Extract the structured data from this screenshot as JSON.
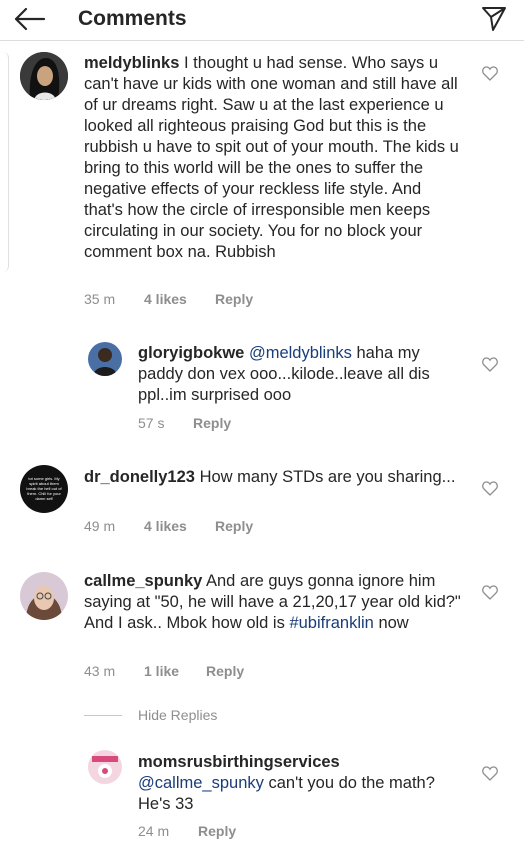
{
  "header": {
    "title": "Comments",
    "back_icon": "arrow-left-icon",
    "send_icon": "paper-plane-icon"
  },
  "comments": [
    {
      "username": "meldyblinks",
      "text": "I thought u had sense. Who says u can't have ur kids with one woman and still have all of ur dreams right. Saw u at the last experience u looked all righteous praising God but this is the rubbish u have to spit out of your mouth. The kids u bring to this world will be the ones to suffer the negative effects of your reckless life style. And that's how the circle of irresponsible men keeps circulating in our society. You for no block your comment box na. Rubbish",
      "time": "35 m",
      "likes": "4 likes",
      "reply": "Reply",
      "replies": [
        {
          "username": "gloryigbokwe",
          "mention": "@meldyblinks",
          "text": "haha my paddy don vex ooo...kilode..leave all dis ppl..im surprised ooo",
          "time": "57 s",
          "reply": "Reply"
        }
      ]
    },
    {
      "username": "dr_donelly123",
      "text": "How many STDs are you sharing...",
      "time": "49 m",
      "likes": "4 likes",
      "reply": "Reply",
      "avatar_text": "tot some girls. My spirit about them break the hell out of them. Chill for your damn self"
    },
    {
      "username": "callme_spunky",
      "text_before": "And are guys gonna ignore him saying at \"50, he will have a 21,20,17 year old kid?\" And I ask.. Mbok how old is",
      "hashtag": "#ubifranklin",
      "text_after": "now",
      "time": "43 m",
      "likes": "1 like",
      "reply": "Reply",
      "hide_replies": "Hide Replies",
      "replies": [
        {
          "username": "momsrusbirthingservices",
          "mention": "@callme_spunky",
          "text": "can't you do the math? He's 33",
          "time": "24 m",
          "reply": "Reply"
        }
      ]
    }
  ],
  "icons": {
    "like": "heart-outline-icon"
  },
  "colors": {
    "text": "#262626",
    "meta": "#8e8e8e",
    "mention": "#1a3d7a",
    "divider": "#dcdcdc"
  }
}
